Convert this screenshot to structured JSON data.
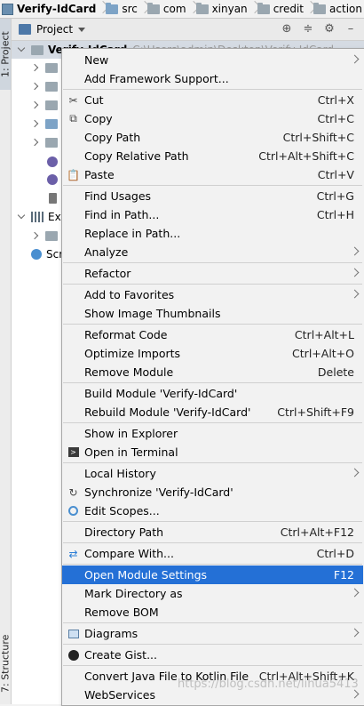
{
  "breadcrumb": [
    "Verify-IdCard",
    "src",
    "com",
    "xinyan",
    "credit",
    "action"
  ],
  "left_strip": {
    "project_tab": "1: Project",
    "structure_tab": "7: Structure"
  },
  "panel": {
    "title": "Project"
  },
  "tree": {
    "root_name": "Verify-IdCard",
    "root_path": "C:\\Users\\admin\\Desktop\\Verify-IdCard",
    "external_libraries": "Ext",
    "scratches": "Scr"
  },
  "menu": {
    "items": [
      {
        "label": "New",
        "shortcut": "",
        "submenu": true,
        "icon": ""
      },
      {
        "label": "Add Framework Support...",
        "shortcut": "",
        "submenu": false,
        "icon": ""
      },
      {
        "label": "Cut",
        "shortcut": "Ctrl+X",
        "submenu": false,
        "icon": "cut-icon"
      },
      {
        "label": "Copy",
        "shortcut": "Ctrl+C",
        "submenu": false,
        "icon": "copy-icon"
      },
      {
        "label": "Copy Path",
        "shortcut": "Ctrl+Shift+C",
        "submenu": false,
        "icon": ""
      },
      {
        "label": "Copy Relative Path",
        "shortcut": "Ctrl+Alt+Shift+C",
        "submenu": false,
        "icon": ""
      },
      {
        "label": "Paste",
        "shortcut": "Ctrl+V",
        "submenu": false,
        "icon": "paste-icon"
      },
      {
        "label": "Find Usages",
        "shortcut": "Ctrl+G",
        "submenu": false,
        "icon": ""
      },
      {
        "label": "Find in Path...",
        "shortcut": "Ctrl+H",
        "submenu": false,
        "icon": ""
      },
      {
        "label": "Replace in Path...",
        "shortcut": "",
        "submenu": false,
        "icon": ""
      },
      {
        "label": "Analyze",
        "shortcut": "",
        "submenu": true,
        "icon": ""
      },
      {
        "label": "Refactor",
        "shortcut": "",
        "submenu": true,
        "icon": ""
      },
      {
        "label": "Add to Favorites",
        "shortcut": "",
        "submenu": true,
        "icon": ""
      },
      {
        "label": "Show Image Thumbnails",
        "shortcut": "",
        "submenu": false,
        "icon": ""
      },
      {
        "label": "Reformat Code",
        "shortcut": "Ctrl+Alt+L",
        "submenu": false,
        "icon": ""
      },
      {
        "label": "Optimize Imports",
        "shortcut": "Ctrl+Alt+O",
        "submenu": false,
        "icon": ""
      },
      {
        "label": "Remove Module",
        "shortcut": "Delete",
        "submenu": false,
        "icon": ""
      },
      {
        "label": "Build Module 'Verify-IdCard'",
        "shortcut": "",
        "submenu": false,
        "icon": ""
      },
      {
        "label": "Rebuild Module 'Verify-IdCard'",
        "shortcut": "Ctrl+Shift+F9",
        "submenu": false,
        "icon": ""
      },
      {
        "label": "Show in Explorer",
        "shortcut": "",
        "submenu": false,
        "icon": ""
      },
      {
        "label": "Open in Terminal",
        "shortcut": "",
        "submenu": false,
        "icon": "terminal-icon"
      },
      {
        "label": "Local History",
        "shortcut": "",
        "submenu": true,
        "icon": ""
      },
      {
        "label": "Synchronize 'Verify-IdCard'",
        "shortcut": "",
        "submenu": false,
        "icon": "sync-icon"
      },
      {
        "label": "Edit Scopes...",
        "shortcut": "",
        "submenu": false,
        "icon": "scope-icon"
      },
      {
        "label": "Directory Path",
        "shortcut": "Ctrl+Alt+F12",
        "submenu": false,
        "icon": ""
      },
      {
        "label": "Compare With...",
        "shortcut": "Ctrl+D",
        "submenu": false,
        "icon": "compare-icon"
      },
      {
        "label": "Open Module Settings",
        "shortcut": "F12",
        "submenu": false,
        "icon": "",
        "highlighted": true
      },
      {
        "label": "Mark Directory as",
        "shortcut": "",
        "submenu": true,
        "icon": ""
      },
      {
        "label": "Remove BOM",
        "shortcut": "",
        "submenu": false,
        "icon": ""
      },
      {
        "label": "Diagrams",
        "shortcut": "",
        "submenu": true,
        "icon": "diagram-icon"
      },
      {
        "label": "Create Gist...",
        "shortcut": "",
        "submenu": false,
        "icon": "github-icon"
      },
      {
        "label": "Convert Java File to Kotlin File",
        "shortcut": "Ctrl+Alt+Shift+K",
        "submenu": false,
        "icon": ""
      },
      {
        "label": "WebServices",
        "shortcut": "",
        "submenu": true,
        "icon": ""
      }
    ]
  },
  "watermark": "https://blog.csdn.net/lihua5413"
}
